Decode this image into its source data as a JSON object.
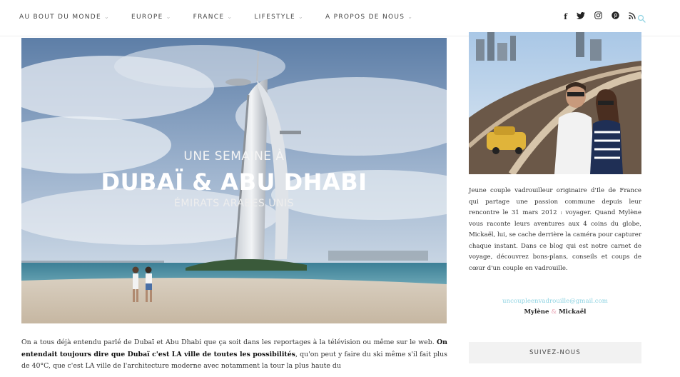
{
  "nav": {
    "items": [
      {
        "label": "AU BOUT DU MONDE"
      },
      {
        "label": "EUROPE"
      },
      {
        "label": "FRANCE"
      },
      {
        "label": "LIFESTYLE"
      },
      {
        "label": "A PROPOS DE NOUS"
      }
    ],
    "chevron": "⌄",
    "social_icons": [
      "facebook-icon",
      "twitter-icon",
      "instagram-icon",
      "pinterest-icon",
      "rss-icon"
    ],
    "social_glyphs": [
      "f",
      "🐦",
      "◎",
      "℗",
      "⋰"
    ],
    "search_icon": "search-icon",
    "accent_color": "#8fd3e2"
  },
  "hero": {
    "kicker": "UNE SEMAINE À",
    "title": "DUBAÏ & ABU DHABI",
    "subtitle": "ÉMIRATS ARABES UNIS"
  },
  "article": {
    "p1_part1": "On a tous déjà entendu parlé de Dubaï et Abu Dhabi que ça soit dans les reportages à la télévision ou même sur le web. ",
    "p1_bold": "On entendait toujours dire que Dubaï c'est LA ville de toutes les possibilités",
    "p1_part2": ", qu'on peut y faire du ski même s'il fait plus de 40°C, que c'est LA ville de l'architecture moderne avec notamment la tour la plus haute du"
  },
  "sidebar": {
    "about_text": "Jeune couple vadrouilleur originaire d'Ile de France qui partage une passion commune depuis leur rencontre le 31 mars 2012 : voyager. Quand Mylène vous raconte leurs aventures aux 4 coins du globe, Mickaël, lui, se cache derrière la caméra pour capturer chaque instant. Dans ce blog qui est notre carnet de voyage, découvrez bons-plans, conseils et coups de cœur d'un couple en vadrouille.",
    "email": "uncoupleenvadrouille@gmail.com",
    "name1": "Mylène",
    "amp": "&",
    "name2": "Mickaël",
    "follow_label": "SUIVEZ-NOUS"
  }
}
